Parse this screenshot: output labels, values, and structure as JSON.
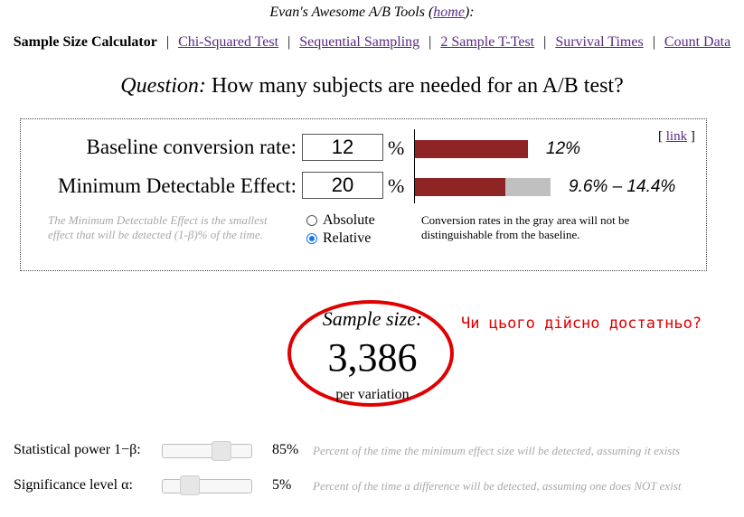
{
  "header": {
    "prefix": "Evan's Awesome A/B Tools (",
    "home_link": "home",
    "suffix": "):"
  },
  "nav": {
    "current": "Sample Size Calculator",
    "links": [
      "Chi-Squared Test",
      "Sequential Sampling",
      "2 Sample T-Test",
      "Survival Times",
      "Count Data"
    ],
    "separator": "|"
  },
  "question": {
    "prefix": "Question:",
    "text": "How many subjects are needed for an A/B test?"
  },
  "form": {
    "link_open": "[",
    "link_label": "link",
    "link_close": "]",
    "baseline": {
      "label": "Baseline conversion rate:",
      "value": "12",
      "unit": "%",
      "bar_text": "12%",
      "bar_fill_fraction": 0.12
    },
    "mde": {
      "label": "Minimum Detectable Effect:",
      "value": "20",
      "unit": "%",
      "range_text": "9.6% – 14.4%",
      "bar_fill_fraction": 0.096,
      "bar_gray_fraction": 0.048
    },
    "mde_note": "The Minimum Detectable Effect is the smallest effect that will be detected (1-β)% of the time.",
    "radio_options": [
      {
        "label": "Absolute",
        "selected": false
      },
      {
        "label": "Relative",
        "selected": true
      }
    ],
    "gray_note": "Conversion rates in the gray area will not be distinguishable from the baseline."
  },
  "result": {
    "label": "Sample size:",
    "value": "3,386",
    "unit": "per variation"
  },
  "annotation": "Чи цього дійсно достатньо?",
  "sliders": [
    {
      "label": "Statistical power 1−β:",
      "value": "85%",
      "level": 0.85,
      "description": "Percent of the time the minimum effect size will be detected, assuming it exists"
    },
    {
      "label": "Significance level α:",
      "value": "5%",
      "level": 0.05,
      "description": "Percent of the time a difference will be detected, assuming one does NOT exist"
    }
  ],
  "colors": {
    "bar_fill": "#8e2424",
    "bar_gray": "#c0c0c0",
    "annotation": "#e00000",
    "link": "#5b2a86",
    "radio_selected": "#1a73e8"
  }
}
